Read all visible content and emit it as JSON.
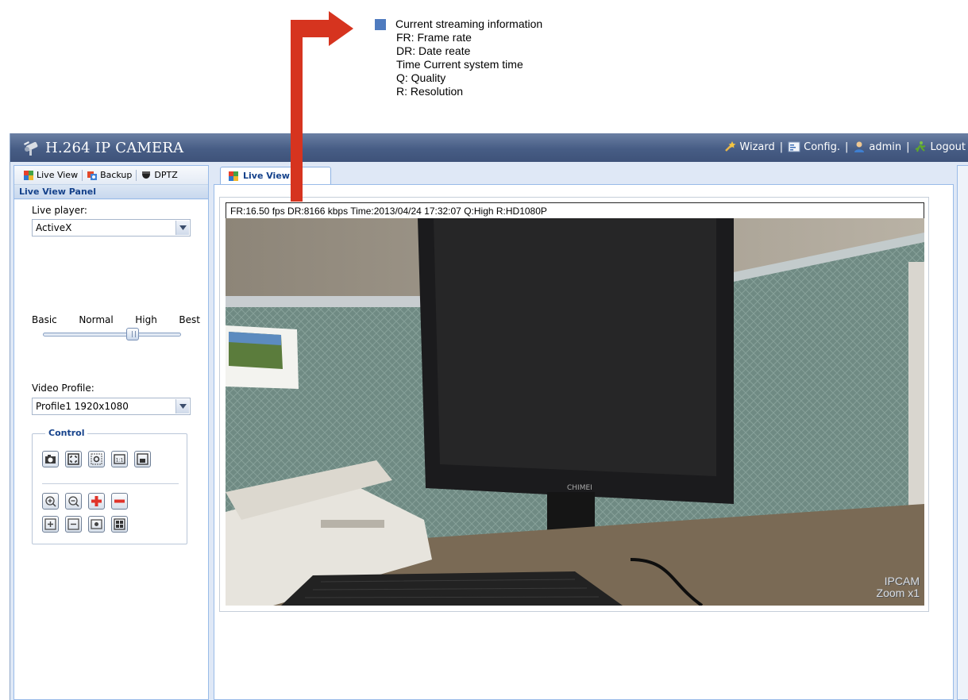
{
  "annotation": {
    "heading": "Current streaming information",
    "lines": [
      "FR: Frame rate",
      "DR: Date reate",
      "Time Current system time",
      "Q: Quality",
      "R: Resolution"
    ],
    "bullet_color": "#4f7bbf",
    "arrow_color": "#d6341f"
  },
  "app": {
    "title": "H.264 IP CAMERA",
    "logo_icon": "camera-icon",
    "top_links": [
      {
        "label": "Wizard",
        "icon": "wizard-icon"
      },
      {
        "label": "Config.",
        "icon": "config-icon"
      },
      {
        "label": "admin",
        "icon": "user-icon"
      },
      {
        "label": "Logout",
        "icon": "logout-icon"
      }
    ]
  },
  "left_panel": {
    "tabs": [
      {
        "label": "Live View",
        "icon": "live-view-icon"
      },
      {
        "label": "Backup",
        "icon": "backup-icon"
      },
      {
        "label": "DPTZ",
        "icon": "dptz-icon"
      }
    ],
    "panel_title": "Live View Panel",
    "live_player": {
      "label": "Live player:",
      "value": "ActiveX"
    },
    "quality": {
      "levels": [
        "Basic",
        "Normal",
        "High",
        "Best"
      ],
      "selected": "High"
    },
    "video_profile": {
      "label": "Video Profile:",
      "value": "Profile1 1920x1080"
    },
    "control": {
      "title": "Control",
      "row1": [
        "snapshot-icon",
        "fullscreen-icon",
        "auto-focus-icon",
        "original-size-icon",
        "fit-window-icon"
      ],
      "row2": [
        "zoom-in-icon",
        "zoom-out-icon",
        "digital-zoom-in-icon",
        "digital-zoom-out-icon"
      ],
      "row3": [
        "focus-near-icon",
        "focus-far-icon",
        "record-icon",
        "multi-view-icon"
      ]
    }
  },
  "main": {
    "tab_label": "Live View",
    "stream_info": "FR:16.50 fps  DR:8166 kbps Time:2013/04/24 17:32:07 Q:High R:HD1080P",
    "overlay": {
      "line1": "IPCAM",
      "line2": "Zoom x1"
    },
    "monitor_brand": "CHIMEI"
  }
}
